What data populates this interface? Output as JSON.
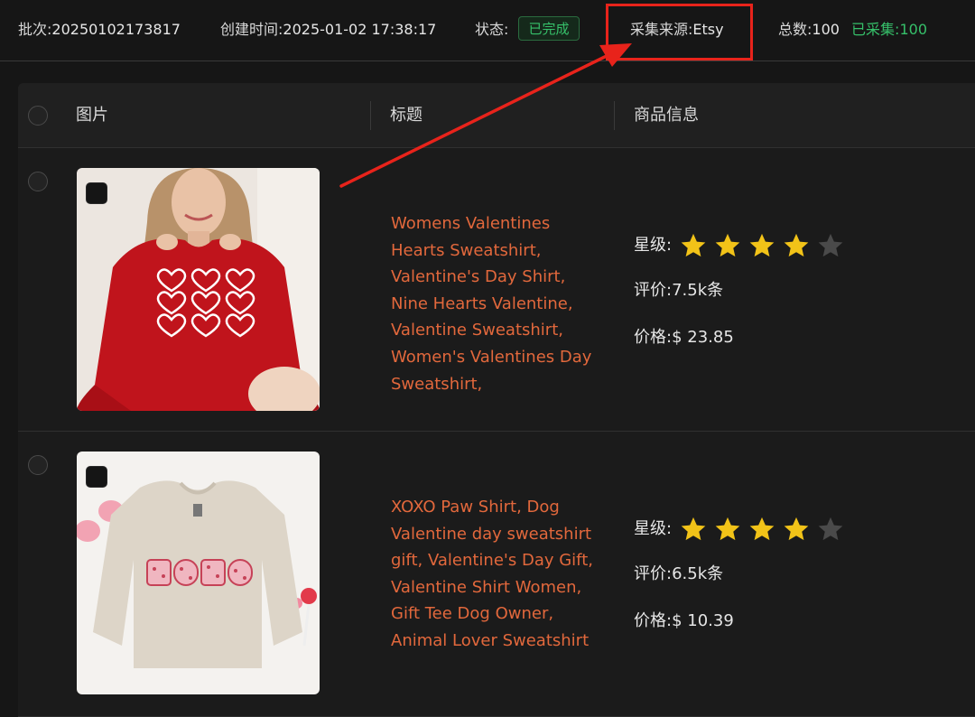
{
  "info": {
    "batch_label": "批次:",
    "batch_value": "20250102173817",
    "created_label": "创建时间:",
    "created_value": "2025-01-02 17:38:17",
    "status_label": "状态:",
    "status_value": "已完成",
    "source_label": "采集来源:",
    "source_value": "Etsy",
    "total_label": "总数:",
    "total_value": "100",
    "collected_label": "已采集:",
    "collected_value": "100"
  },
  "table": {
    "columns": [
      "图片",
      "标题",
      "商品信息"
    ]
  },
  "labels": {
    "rating": "星级:",
    "reviews": "评价:",
    "price": "价格:"
  },
  "products": [
    {
      "title": "Womens Valentines Hearts Sweatshirt, Valentine's Day Shirt, Nine Hearts Valentine, Valentine Sweatshirt, Women's Valentines Day Sweatshirt,",
      "rating": 4,
      "reviews": "7.5k条",
      "price": "$ 23.85",
      "image_icon": "red-sweatshirt-hearts-photo"
    },
    {
      "title": "XOXO Paw Shirt, Dog Valentine day sweatshirt gift, Valentine's Day Gift, Valentine Shirt Women, Gift Tee Dog Owner, Animal Lover Sweatshirt",
      "rating": 4,
      "reviews": "6.5k条",
      "price": "$ 10.39",
      "image_icon": "beige-sweatshirt-xoxo-photo"
    }
  ],
  "colors": {
    "accent_title": "#e2683c",
    "success": "#36c06a",
    "star_on": "#f2c318",
    "star_off": "#4a4a4a",
    "annotation_red": "#e8231b"
  }
}
